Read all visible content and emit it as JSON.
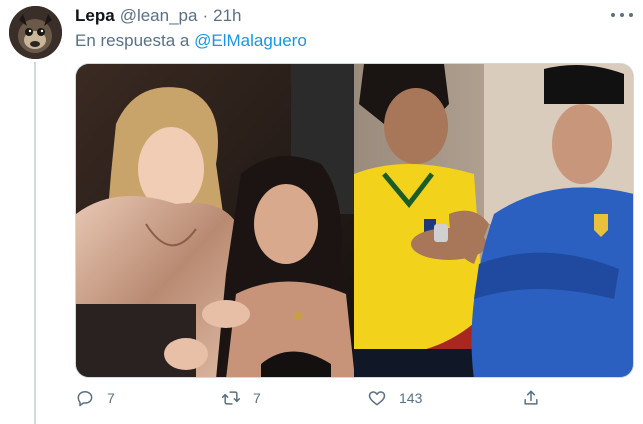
{
  "tweet": {
    "display_name": "Lepa",
    "handle": "@lean_pa",
    "separator": "·",
    "time": "21h",
    "reply_prefix": "En respuesta a",
    "reply_to": "@ElMalaguero",
    "actions": {
      "reply_count": "7",
      "retweet_count": "7",
      "like_count": "143"
    }
  },
  "icons": {
    "more": "more-icon",
    "reply": "reply-icon",
    "retweet": "retweet-icon",
    "like": "heart-icon",
    "share": "share-icon"
  },
  "colors": {
    "link": "#1b95e0",
    "secondary_text": "#5b7083",
    "divider": "#cfd9de"
  }
}
